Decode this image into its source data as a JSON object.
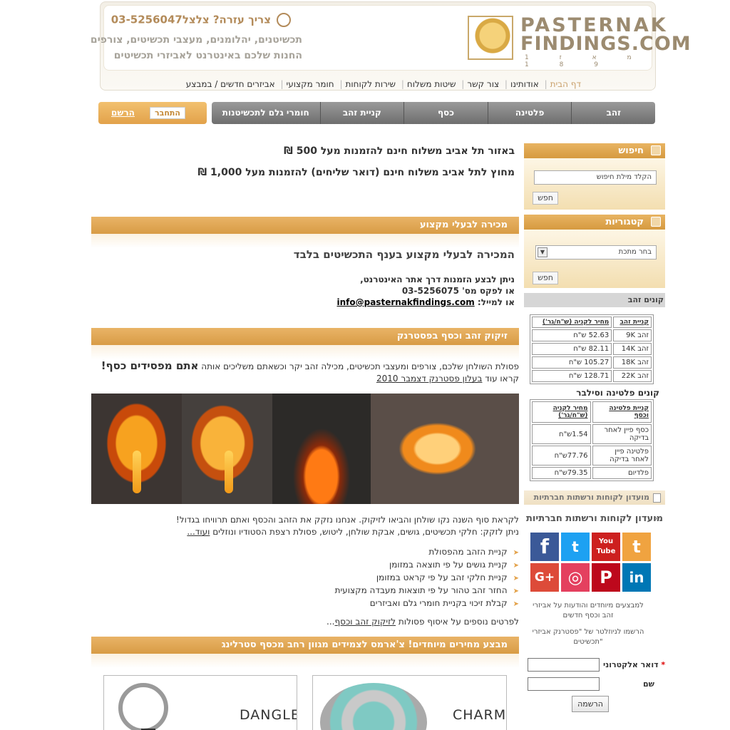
{
  "header": {
    "logo_line1": "PASTERNAK",
    "logo_line2": "FINDINGS.COM",
    "logo_line3": "מ א ז  1 9 8 1",
    "help": "צריך עזרה? צלצל03-5256047",
    "tagline1": "תכשיטנים, יהלומנים, מעצבי תכשיטים, צורפים",
    "tagline2": "החנות שלכם באינטרנט לאביזרי תכשיטים"
  },
  "topnav": [
    "דף הבית",
    "אודותינו",
    "צור קשר",
    "שיטות משלוח",
    "שירות לקוחות",
    "חומר מקצועי",
    "אביזרים חדשים / במבצע"
  ],
  "mainmenu": [
    "זהב",
    "פלטינה",
    "כסף",
    "קניית זהב",
    "חומרי גלם לתכשיטנות"
  ],
  "auth": {
    "login": "התחבר",
    "register": "הרשם"
  },
  "search": {
    "title": "חיפוש",
    "placeholder": "הקלד מילת חיפוש",
    "button": "חפש"
  },
  "categories": {
    "title": "קטגוריות",
    "selected": "בחר מתכת",
    "button": "חפש"
  },
  "gold_prices": {
    "title": "קונים זהב",
    "headers": [
      "קניית זהב",
      "מחיר לקניה (ש\"ח/גר')"
    ],
    "rows": [
      [
        "זהב 9K",
        "52.63 ש\"ח"
      ],
      [
        "זהב 14K",
        "82.11 ש\"ח"
      ],
      [
        "זהב 18K",
        "105.27 ש\"ח"
      ],
      [
        "זהב 22K",
        "128.71 ש\"ח"
      ]
    ]
  },
  "plat_prices": {
    "title": "קונים פלטינה וסילבר",
    "headers": [
      "קניית פלטינה וכסף",
      "מחיר לקניה (ש\"ח/גר')"
    ],
    "rows": [
      [
        "כסף פיין לאחר בדיקה",
        "1.54ש\"ח"
      ],
      [
        "פלטינה פיין לאחר בדיקה",
        "77.76ש\"ח"
      ],
      [
        "פלדיום",
        "79.35ש\"ח"
      ]
    ]
  },
  "club": {
    "head": "מועדון לקוחות ורשתות חברתיות",
    "title": "מועדון לקוחות ורשתות חברתיות",
    "social": [
      "facebook-icon",
      "twitter-icon",
      "youtube-icon",
      "blogger-icon",
      "googleplus-icon",
      "instagram-icon",
      "pinterest-icon",
      "linkedin-icon"
    ],
    "youtube_text": "You Tube",
    "news1": "למבצעים מיוחדים והודעות על אביזרי זהב וכסף חדשים",
    "news2": "הרשמו לניוזלטר של \"פסטרנק אביזרי תכשיטים\"",
    "email_label": "דואר אלקטרוני",
    "required_mark": "*",
    "name_label": "שם",
    "button": "הרשמה"
  },
  "shipping": {
    "line1": "באזור תל אביב משלוח חינם להזמנות מעל 500 ₪",
    "line2": "מחוץ לתל אביב משלוח חינם (דואר שליחים) להזמנות מעל 1,000 ₪"
  },
  "pro": {
    "bar": "מכירה לבעלי מקצוע",
    "title": "המכירה לבעלי מקצוע בענף התכשיטים בלבד",
    "line1": "ניתן לבצע הזמנות דרך אתר האינטרנט,",
    "line2": "או לפקס מס' 03-5256075",
    "line3_label": "או למייל:",
    "email": "info@pasternakfindings.com"
  },
  "refine": {
    "bar": "זיקוק זהב וכסף בפסטרנק",
    "p1_text": "פסולת השולחן שלכם, צורפים ומעצבי תכשיטים, מכילה זהב יקר וכשאתם משליכים אותה",
    "p1_bold": "אתם מפסידים כסף!",
    "p2_text": "קראו עוד",
    "p2_link": "בעלון פסטרנק דצמבר 2010",
    "p3": "לקראת סוף השנה  נקו שולחן והביאו לזיקוק. אנחנו נזקק את הזהב והכסף ואתם תרוויחו בגדול!",
    "p4_text": "ניתן לזקק: חלקי תכשיטים, גושים, אבקת שולחן, ליטוש, פסולת רצפת הסטודיו ונוזלים",
    "p4_link": "ועוד...",
    "bullets": [
      "קניית הזהב מהפסולת",
      "קניית גושים על פי תוצאה במזומן",
      "קניית חלקי זהב על פי קראט במזומן",
      "החזר זהב טהור על פי תוצאות מעבדה מקצועית",
      "קבלת זיכוי בקניית חומרי גלם ואביזרים"
    ],
    "more_text": "לפרטים נוספים על איסוף פסולות",
    "more_link": "לזיקוק זהב וכסף",
    "more_tail": "..."
  },
  "sale": {
    "bar": "מבצע מחירים מיוחדים! צ'ארמס לצמידים מגוון רחב מכסף סטרלינג",
    "prod1_label": "DANGLE",
    "prod2_label": "CHARM"
  }
}
